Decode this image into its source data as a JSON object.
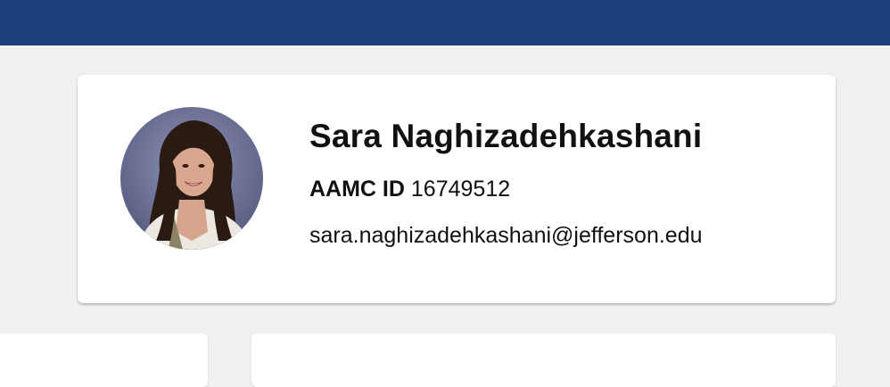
{
  "header": {
    "bar_color": "#1b3f7a"
  },
  "profile": {
    "avatar_icon": "profile-photo",
    "name": "Sara Naghizadehkashani",
    "aamc_label": "AAMC ID",
    "aamc_id": "16749512",
    "email": "sara.naghizadehkashani@jefferson.edu"
  }
}
